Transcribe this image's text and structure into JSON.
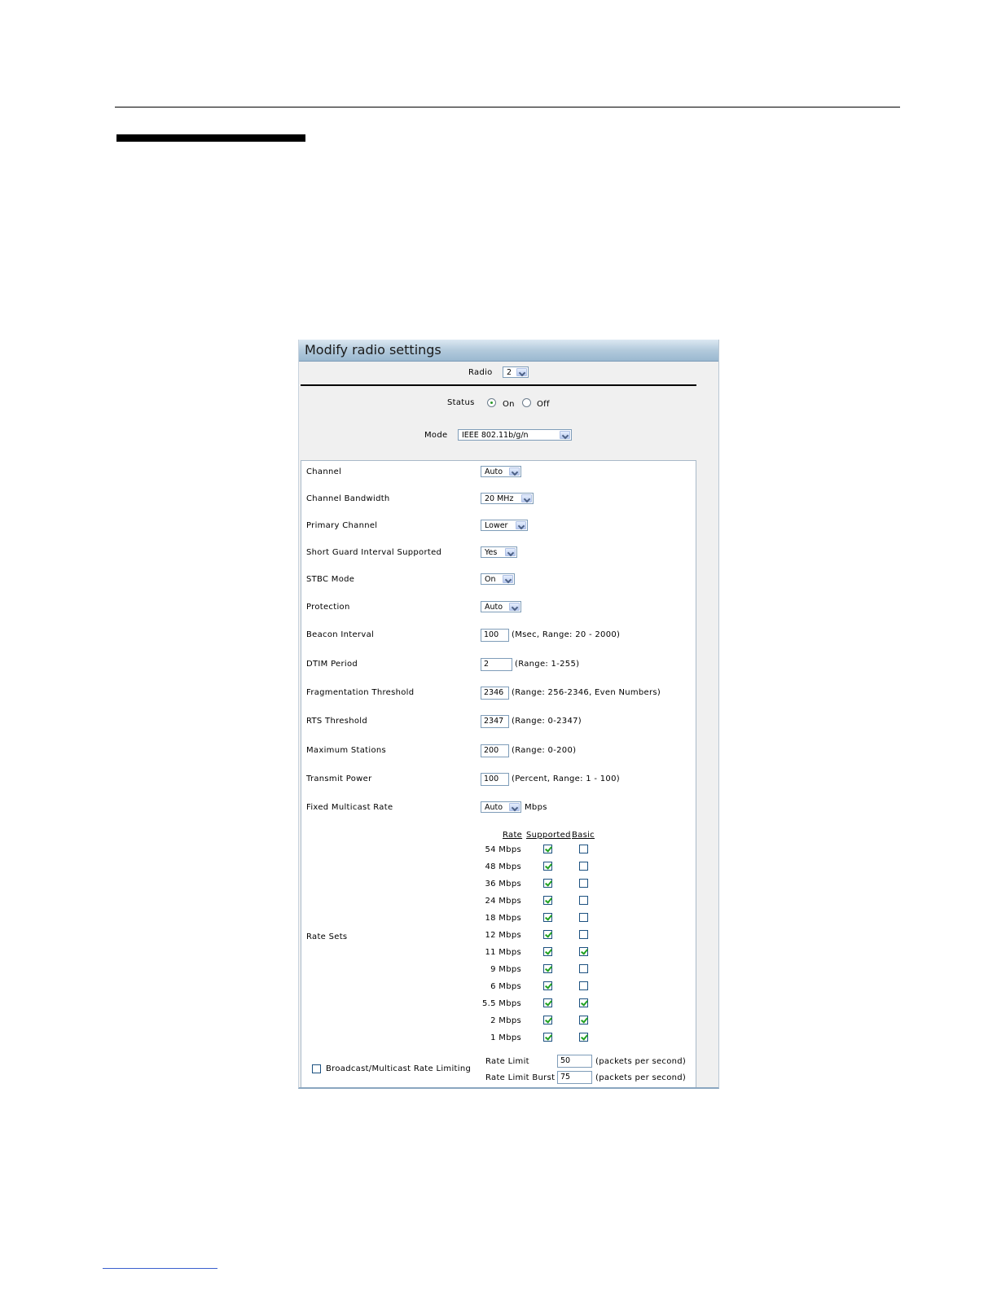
{
  "panel": {
    "title": "Modify radio settings",
    "radio": {
      "label": "Radio",
      "value": "2"
    },
    "status": {
      "label": "Status",
      "on_label": "On",
      "off_label": "Off",
      "selected": "On"
    },
    "mode": {
      "label": "Mode",
      "value": "IEEE 802.11b/g/n"
    }
  },
  "settings": {
    "channel": {
      "label": "Channel",
      "value": "Auto"
    },
    "channel_bandwidth": {
      "label": "Channel Bandwidth",
      "value": "20 MHz"
    },
    "primary_channel": {
      "label": "Primary Channel",
      "value": "Lower"
    },
    "short_guard": {
      "label": "Short Guard Interval Supported",
      "value": "Yes"
    },
    "stbc_mode": {
      "label": "STBC Mode",
      "value": "On"
    },
    "protection": {
      "label": "Protection",
      "value": "Auto"
    },
    "beacon_interval": {
      "label": "Beacon Interval",
      "value": "100",
      "hint": "(Msec, Range: 20 - 2000)"
    },
    "dtim_period": {
      "label": "DTIM Period",
      "value": "2",
      "hint": "(Range: 1-255)"
    },
    "frag_threshold": {
      "label": "Fragmentation Threshold",
      "value": "2346",
      "hint": "(Range: 256-2346, Even Numbers)"
    },
    "rts_threshold": {
      "label": "RTS Threshold",
      "value": "2347",
      "hint": "(Range: 0-2347)"
    },
    "max_stations": {
      "label": "Maximum Stations",
      "value": "200",
      "hint": "(Range: 0-200)"
    },
    "transmit_power": {
      "label": "Transmit Power",
      "value": "100",
      "hint": "(Percent, Range: 1 - 100)"
    },
    "fixed_multicast": {
      "label": "Fixed Multicast Rate",
      "value": "Auto",
      "unit": "Mbps"
    }
  },
  "rate_sets": {
    "label": "Rate Sets",
    "headers": {
      "rate": "Rate",
      "supported": "Supported",
      "basic": "Basic"
    },
    "rows": [
      {
        "rate": "54 Mbps",
        "supported": true,
        "basic": false
      },
      {
        "rate": "48 Mbps",
        "supported": true,
        "basic": false
      },
      {
        "rate": "36 Mbps",
        "supported": true,
        "basic": false
      },
      {
        "rate": "24 Mbps",
        "supported": true,
        "basic": false
      },
      {
        "rate": "18 Mbps",
        "supported": true,
        "basic": false
      },
      {
        "rate": "12 Mbps",
        "supported": true,
        "basic": false
      },
      {
        "rate": "11 Mbps",
        "supported": true,
        "basic": true
      },
      {
        "rate": "9 Mbps",
        "supported": true,
        "basic": false
      },
      {
        "rate": "6 Mbps",
        "supported": true,
        "basic": false
      },
      {
        "rate": "5.5 Mbps",
        "supported": true,
        "basic": true
      },
      {
        "rate": "2 Mbps",
        "supported": true,
        "basic": true
      },
      {
        "rate": "1 Mbps",
        "supported": true,
        "basic": true
      }
    ]
  },
  "rate_limiting": {
    "checkbox_label": "Broadcast/Multicast Rate Limiting",
    "checked": false,
    "rate_limit": {
      "label": "Rate Limit",
      "value": "50",
      "unit": "(packets per second)"
    },
    "rate_limit_burst": {
      "label": "Rate Limit Burst",
      "value": "75",
      "unit": "(packets per second)"
    }
  }
}
